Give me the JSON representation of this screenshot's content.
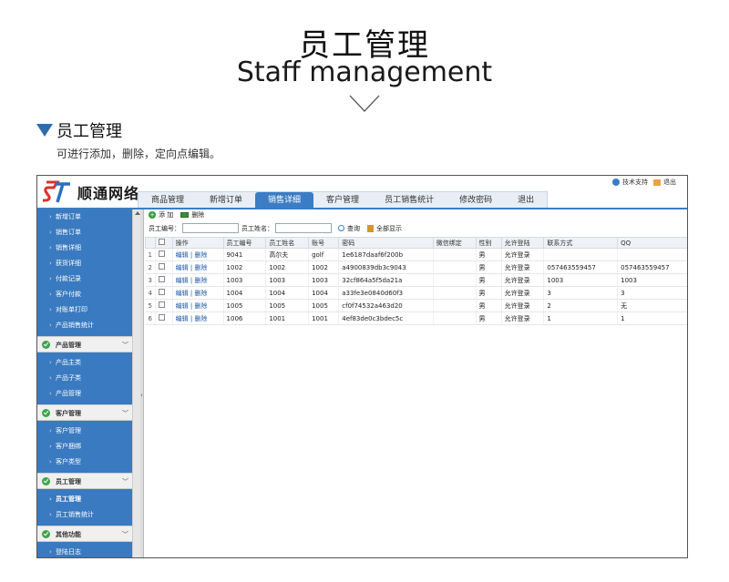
{
  "hero": {
    "title": "员工管理",
    "subtitle": "Staff management"
  },
  "section": {
    "title": "员工管理",
    "description": "可进行添加，删除，定向点编辑。"
  },
  "app": {
    "logo_text": "顺通网络",
    "top_links": {
      "support": "技术支持",
      "logout": "退出"
    },
    "nav_tabs": [
      "商品管理",
      "新增订单",
      "销售详细",
      "客户管理",
      "员工销售统计",
      "修改密码",
      "退出"
    ],
    "nav_active": "销售详细",
    "sidebar": {
      "items_top": [
        "新增订单",
        "销售订单",
        "销售详细",
        "获货详细",
        "付款记录",
        "客户付款",
        "对账单打印",
        "产品销售统计"
      ],
      "groups": [
        {
          "title": "产品管理",
          "items": [
            "产品主类",
            "产品子类",
            "产品管理"
          ]
        },
        {
          "title": "客户管理",
          "items": [
            "客户管理",
            "客户捆绑",
            "客户类型"
          ]
        },
        {
          "title": "员工管理",
          "items": [
            "员工管理",
            "员工销售统计"
          ]
        },
        {
          "title": "其他功能",
          "items": [
            "登陆日志"
          ]
        }
      ]
    },
    "toolbar": {
      "add": "添 加",
      "delete": "删除"
    },
    "search": {
      "id_label": "员工编号：",
      "name_label": "员工姓名：",
      "query": "查询",
      "show_all": "全部显示"
    },
    "table": {
      "headers": [
        "操作",
        "员工编号",
        "员工姓名",
        "账号",
        "密码",
        "微信绑定",
        "性别",
        "允许登陆",
        "联系方式",
        "QQ"
      ],
      "rows": [
        {
          "idx": "1",
          "action": "编辑 | 删除",
          "emp_id": "9041",
          "name": "高尔夫",
          "account": "golf",
          "password": "1e6187daaf6f200b",
          "wechat": "",
          "gender": "男",
          "login": "允许登录",
          "contact": "",
          "qq": ""
        },
        {
          "idx": "2",
          "action": "编辑 | 删除",
          "emp_id": "1002",
          "name": "1002",
          "account": "1002",
          "password": "a4900839db3c9043",
          "wechat": "",
          "gender": "男",
          "login": "允许登录",
          "contact": "057463559457",
          "qq": "057463559457"
        },
        {
          "idx": "3",
          "action": "编辑 | 删除",
          "emp_id": "1003",
          "name": "1003",
          "account": "1003",
          "password": "32cf864a5f5da21a",
          "wechat": "",
          "gender": "男",
          "login": "允许登录",
          "contact": "1003",
          "qq": "1003"
        },
        {
          "idx": "4",
          "action": "编辑 | 删除",
          "emp_id": "1004",
          "name": "1004",
          "account": "1004",
          "password": "a33fe3e0840d60f3",
          "wechat": "",
          "gender": "男",
          "login": "允许登录",
          "contact": "3",
          "qq": "3"
        },
        {
          "idx": "5",
          "action": "编辑 | 删除",
          "emp_id": "1005",
          "name": "1005",
          "account": "1005",
          "password": "cf0f74532a463d20",
          "wechat": "",
          "gender": "男",
          "login": "允许登录",
          "contact": "2",
          "qq": "无"
        },
        {
          "idx": "6",
          "action": "编辑 | 删除",
          "emp_id": "1006",
          "name": "1001",
          "account": "1001",
          "password": "4ef83de0c3bdec5c",
          "wechat": "",
          "gender": "男",
          "login": "允许登录",
          "contact": "1",
          "qq": "1"
        }
      ]
    }
  },
  "colors": {
    "accent": "#3b7dc4",
    "sidebar": "#3a7ac0",
    "section_triangle": "#2f6cab"
  }
}
